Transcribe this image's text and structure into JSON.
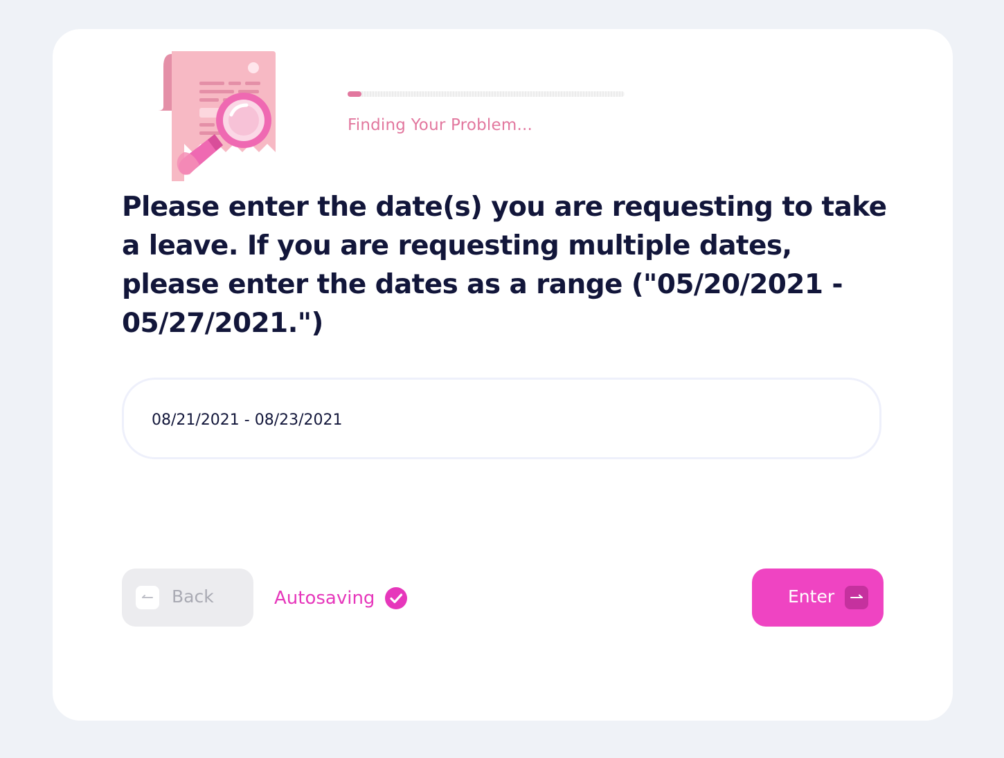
{
  "progress": {
    "fraction": 0.05,
    "status_label": "Finding Your Problem..."
  },
  "question": {
    "text": "Please enter the date(s) you are requesting to take a leave. If you are requesting multiple dates, please enter the dates as a range (\"05/20/2021 - 05/27/2021.\")"
  },
  "answer": {
    "value": "08/21/2021 - 08/23/2021"
  },
  "footer": {
    "back_label": "Back",
    "autosave_label": "Autosaving",
    "enter_label": "Enter"
  },
  "icons": {
    "back": "arrow-left-icon",
    "autosave": "check-circle-icon",
    "enter": "arrow-right-icon",
    "illustration": "document-search-illustration"
  },
  "colors": {
    "accent": "#ef44c2",
    "autosave": "#e637bb",
    "status": "#e2779e",
    "heading": "#12163a",
    "background": "#eff2f7"
  }
}
